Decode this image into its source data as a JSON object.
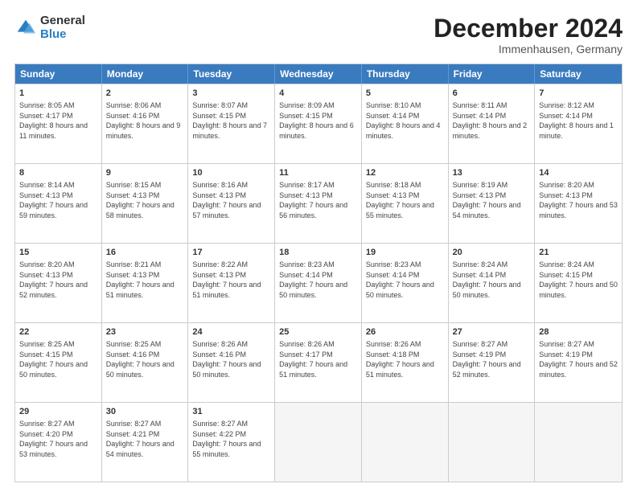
{
  "header": {
    "logo_general": "General",
    "logo_blue": "Blue",
    "month_title": "December 2024",
    "location": "Immenhausen, Germany"
  },
  "days_of_week": [
    "Sunday",
    "Monday",
    "Tuesday",
    "Wednesday",
    "Thursday",
    "Friday",
    "Saturday"
  ],
  "weeks": [
    [
      {
        "day": "1",
        "sunrise": "Sunrise: 8:05 AM",
        "sunset": "Sunset: 4:17 PM",
        "daylight": "Daylight: 8 hours and 11 minutes."
      },
      {
        "day": "2",
        "sunrise": "Sunrise: 8:06 AM",
        "sunset": "Sunset: 4:16 PM",
        "daylight": "Daylight: 8 hours and 9 minutes."
      },
      {
        "day": "3",
        "sunrise": "Sunrise: 8:07 AM",
        "sunset": "Sunset: 4:15 PM",
        "daylight": "Daylight: 8 hours and 7 minutes."
      },
      {
        "day": "4",
        "sunrise": "Sunrise: 8:09 AM",
        "sunset": "Sunset: 4:15 PM",
        "daylight": "Daylight: 8 hours and 6 minutes."
      },
      {
        "day": "5",
        "sunrise": "Sunrise: 8:10 AM",
        "sunset": "Sunset: 4:14 PM",
        "daylight": "Daylight: 8 hours and 4 minutes."
      },
      {
        "day": "6",
        "sunrise": "Sunrise: 8:11 AM",
        "sunset": "Sunset: 4:14 PM",
        "daylight": "Daylight: 8 hours and 2 minutes."
      },
      {
        "day": "7",
        "sunrise": "Sunrise: 8:12 AM",
        "sunset": "Sunset: 4:14 PM",
        "daylight": "Daylight: 8 hours and 1 minute."
      }
    ],
    [
      {
        "day": "8",
        "sunrise": "Sunrise: 8:14 AM",
        "sunset": "Sunset: 4:13 PM",
        "daylight": "Daylight: 7 hours and 59 minutes."
      },
      {
        "day": "9",
        "sunrise": "Sunrise: 8:15 AM",
        "sunset": "Sunset: 4:13 PM",
        "daylight": "Daylight: 7 hours and 58 minutes."
      },
      {
        "day": "10",
        "sunrise": "Sunrise: 8:16 AM",
        "sunset": "Sunset: 4:13 PM",
        "daylight": "Daylight: 7 hours and 57 minutes."
      },
      {
        "day": "11",
        "sunrise": "Sunrise: 8:17 AM",
        "sunset": "Sunset: 4:13 PM",
        "daylight": "Daylight: 7 hours and 56 minutes."
      },
      {
        "day": "12",
        "sunrise": "Sunrise: 8:18 AM",
        "sunset": "Sunset: 4:13 PM",
        "daylight": "Daylight: 7 hours and 55 minutes."
      },
      {
        "day": "13",
        "sunrise": "Sunrise: 8:19 AM",
        "sunset": "Sunset: 4:13 PM",
        "daylight": "Daylight: 7 hours and 54 minutes."
      },
      {
        "day": "14",
        "sunrise": "Sunrise: 8:20 AM",
        "sunset": "Sunset: 4:13 PM",
        "daylight": "Daylight: 7 hours and 53 minutes."
      }
    ],
    [
      {
        "day": "15",
        "sunrise": "Sunrise: 8:20 AM",
        "sunset": "Sunset: 4:13 PM",
        "daylight": "Daylight: 7 hours and 52 minutes."
      },
      {
        "day": "16",
        "sunrise": "Sunrise: 8:21 AM",
        "sunset": "Sunset: 4:13 PM",
        "daylight": "Daylight: 7 hours and 51 minutes."
      },
      {
        "day": "17",
        "sunrise": "Sunrise: 8:22 AM",
        "sunset": "Sunset: 4:13 PM",
        "daylight": "Daylight: 7 hours and 51 minutes."
      },
      {
        "day": "18",
        "sunrise": "Sunrise: 8:23 AM",
        "sunset": "Sunset: 4:14 PM",
        "daylight": "Daylight: 7 hours and 50 minutes."
      },
      {
        "day": "19",
        "sunrise": "Sunrise: 8:23 AM",
        "sunset": "Sunset: 4:14 PM",
        "daylight": "Daylight: 7 hours and 50 minutes."
      },
      {
        "day": "20",
        "sunrise": "Sunrise: 8:24 AM",
        "sunset": "Sunset: 4:14 PM",
        "daylight": "Daylight: 7 hours and 50 minutes."
      },
      {
        "day": "21",
        "sunrise": "Sunrise: 8:24 AM",
        "sunset": "Sunset: 4:15 PM",
        "daylight": "Daylight: 7 hours and 50 minutes."
      }
    ],
    [
      {
        "day": "22",
        "sunrise": "Sunrise: 8:25 AM",
        "sunset": "Sunset: 4:15 PM",
        "daylight": "Daylight: 7 hours and 50 minutes."
      },
      {
        "day": "23",
        "sunrise": "Sunrise: 8:25 AM",
        "sunset": "Sunset: 4:16 PM",
        "daylight": "Daylight: 7 hours and 50 minutes."
      },
      {
        "day": "24",
        "sunrise": "Sunrise: 8:26 AM",
        "sunset": "Sunset: 4:16 PM",
        "daylight": "Daylight: 7 hours and 50 minutes."
      },
      {
        "day": "25",
        "sunrise": "Sunrise: 8:26 AM",
        "sunset": "Sunset: 4:17 PM",
        "daylight": "Daylight: 7 hours and 51 minutes."
      },
      {
        "day": "26",
        "sunrise": "Sunrise: 8:26 AM",
        "sunset": "Sunset: 4:18 PM",
        "daylight": "Daylight: 7 hours and 51 minutes."
      },
      {
        "day": "27",
        "sunrise": "Sunrise: 8:27 AM",
        "sunset": "Sunset: 4:19 PM",
        "daylight": "Daylight: 7 hours and 52 minutes."
      },
      {
        "day": "28",
        "sunrise": "Sunrise: 8:27 AM",
        "sunset": "Sunset: 4:19 PM",
        "daylight": "Daylight: 7 hours and 52 minutes."
      }
    ],
    [
      {
        "day": "29",
        "sunrise": "Sunrise: 8:27 AM",
        "sunset": "Sunset: 4:20 PM",
        "daylight": "Daylight: 7 hours and 53 minutes."
      },
      {
        "day": "30",
        "sunrise": "Sunrise: 8:27 AM",
        "sunset": "Sunset: 4:21 PM",
        "daylight": "Daylight: 7 hours and 54 minutes."
      },
      {
        "day": "31",
        "sunrise": "Sunrise: 8:27 AM",
        "sunset": "Sunset: 4:22 PM",
        "daylight": "Daylight: 7 hours and 55 minutes."
      },
      {
        "day": "",
        "sunrise": "",
        "sunset": "",
        "daylight": ""
      },
      {
        "day": "",
        "sunrise": "",
        "sunset": "",
        "daylight": ""
      },
      {
        "day": "",
        "sunrise": "",
        "sunset": "",
        "daylight": ""
      },
      {
        "day": "",
        "sunrise": "",
        "sunset": "",
        "daylight": ""
      }
    ]
  ]
}
